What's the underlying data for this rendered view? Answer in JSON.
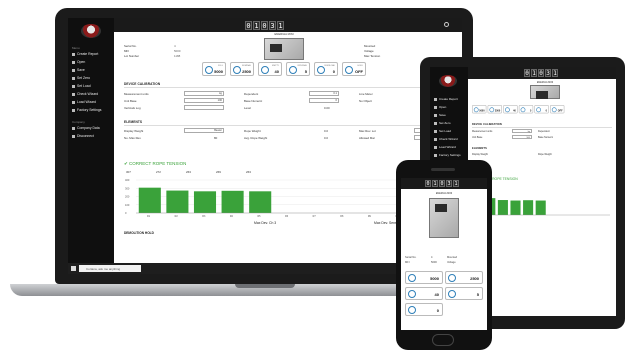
{
  "app": {
    "counter_digits": [
      "0",
      "1",
      "0",
      "3",
      "1"
    ]
  },
  "sidebar": {
    "section_head": "Menu",
    "items": [
      {
        "label": "Create Report"
      },
      {
        "label": "Open"
      },
      {
        "label": "Save"
      },
      {
        "label": "Set Zero"
      },
      {
        "label": "Set Load"
      },
      {
        "label": "Check Wizard"
      },
      {
        "label": "Load Wizard"
      },
      {
        "label": "Factory Settings"
      }
    ],
    "section_head2": "Company",
    "items2": [
      {
        "label": "Company Data"
      },
      {
        "label": "Disconnect"
      }
    ]
  },
  "taskbar": {
    "search_placeholder": "Cortana, ask me anything"
  },
  "device": {
    "title": "ENERGIA MINI",
    "left_fields": [
      {
        "label": "Serial No.",
        "value": "4"
      },
      {
        "label": "MFI",
        "value": "5000"
      },
      {
        "label": "Lot Number",
        "value": "1188"
      }
    ],
    "right_fields": [
      {
        "label": "Mounted",
        "value": ""
      },
      {
        "label": "Voltage",
        "value": ""
      },
      {
        "label": "Max Tension",
        "value": ""
      }
    ]
  },
  "gauges": [
    {
      "label": "FULL",
      "value": "5000"
    },
    {
      "label": "NOMINAL",
      "value": "2500"
    },
    {
      "label": "EMPTY",
      "value": "40"
    },
    {
      "label": "INTERVAL",
      "value": "5"
    },
    {
      "label": "OVERLOAD",
      "value": "0"
    },
    {
      "label": "HOLD",
      "value": "OFF"
    }
  ],
  "calibration": {
    "title": "DEVICE CALIBRATION",
    "rows": [
      {
        "label": "Measurement units",
        "value": "kg",
        "label2": "Dependent",
        "value2": "0.1",
        "label3": "Line Meter",
        "value3": "2"
      },
      {
        "label": "Unit Base",
        "value": "100",
        "label2": "Base Numeric",
        "value2": "0",
        "label3": "No Object",
        "value3": "1"
      },
      {
        "label": "Verticals Log",
        "value": "",
        "label2": "Level",
        "value2": "0.00",
        "label3": "",
        "value3": ""
      }
    ]
  },
  "elements": {
    "title": "ELEMENTS",
    "rows": [
      {
        "label": "Display Weight",
        "value": "Bearer",
        "label2": "Rope Weight",
        "value2": "0.0",
        "label3": "Max Rev. Lot",
        "value3": ""
      },
      {
        "label": "No. Max Rev.",
        "value": "80",
        "label2": "Avg. Rope Weight",
        "value2": "0.0",
        "label3": "Allowed Mar",
        "value3": "0.0"
      }
    ]
  },
  "tension": {
    "title": "CORRECT ROPE TENSION",
    "header_values": [
      "307",
      "272",
      "263",
      "269",
      "263"
    ]
  },
  "chart_data": {
    "type": "bar",
    "categories": [
      "R1",
      "R2",
      "R3",
      "R4",
      "R5",
      "R6",
      "R7",
      "R8",
      "R9",
      "R10"
    ],
    "values": [
      307,
      272,
      263,
      269,
      263,
      0,
      0,
      0,
      0,
      0
    ],
    "ylim": [
      0,
      400
    ],
    "yticks": [
      "400",
      "300",
      "200",
      "100",
      "0"
    ],
    "xlabel": "Max Dev. Ch 3",
    "xlabel2": "Max Dev. Sensor 4",
    "bar_color": "#3aa23a"
  },
  "footer": {
    "title": "DEMOLITION HOLD"
  },
  "tablet": {
    "tension_title": "RECT ROPE TENSION"
  },
  "phone": {
    "gauges": [
      {
        "value": "5000"
      },
      {
        "value": "2500"
      },
      {
        "value": "40"
      },
      {
        "value": "5"
      },
      {
        "value": "0"
      }
    ]
  }
}
